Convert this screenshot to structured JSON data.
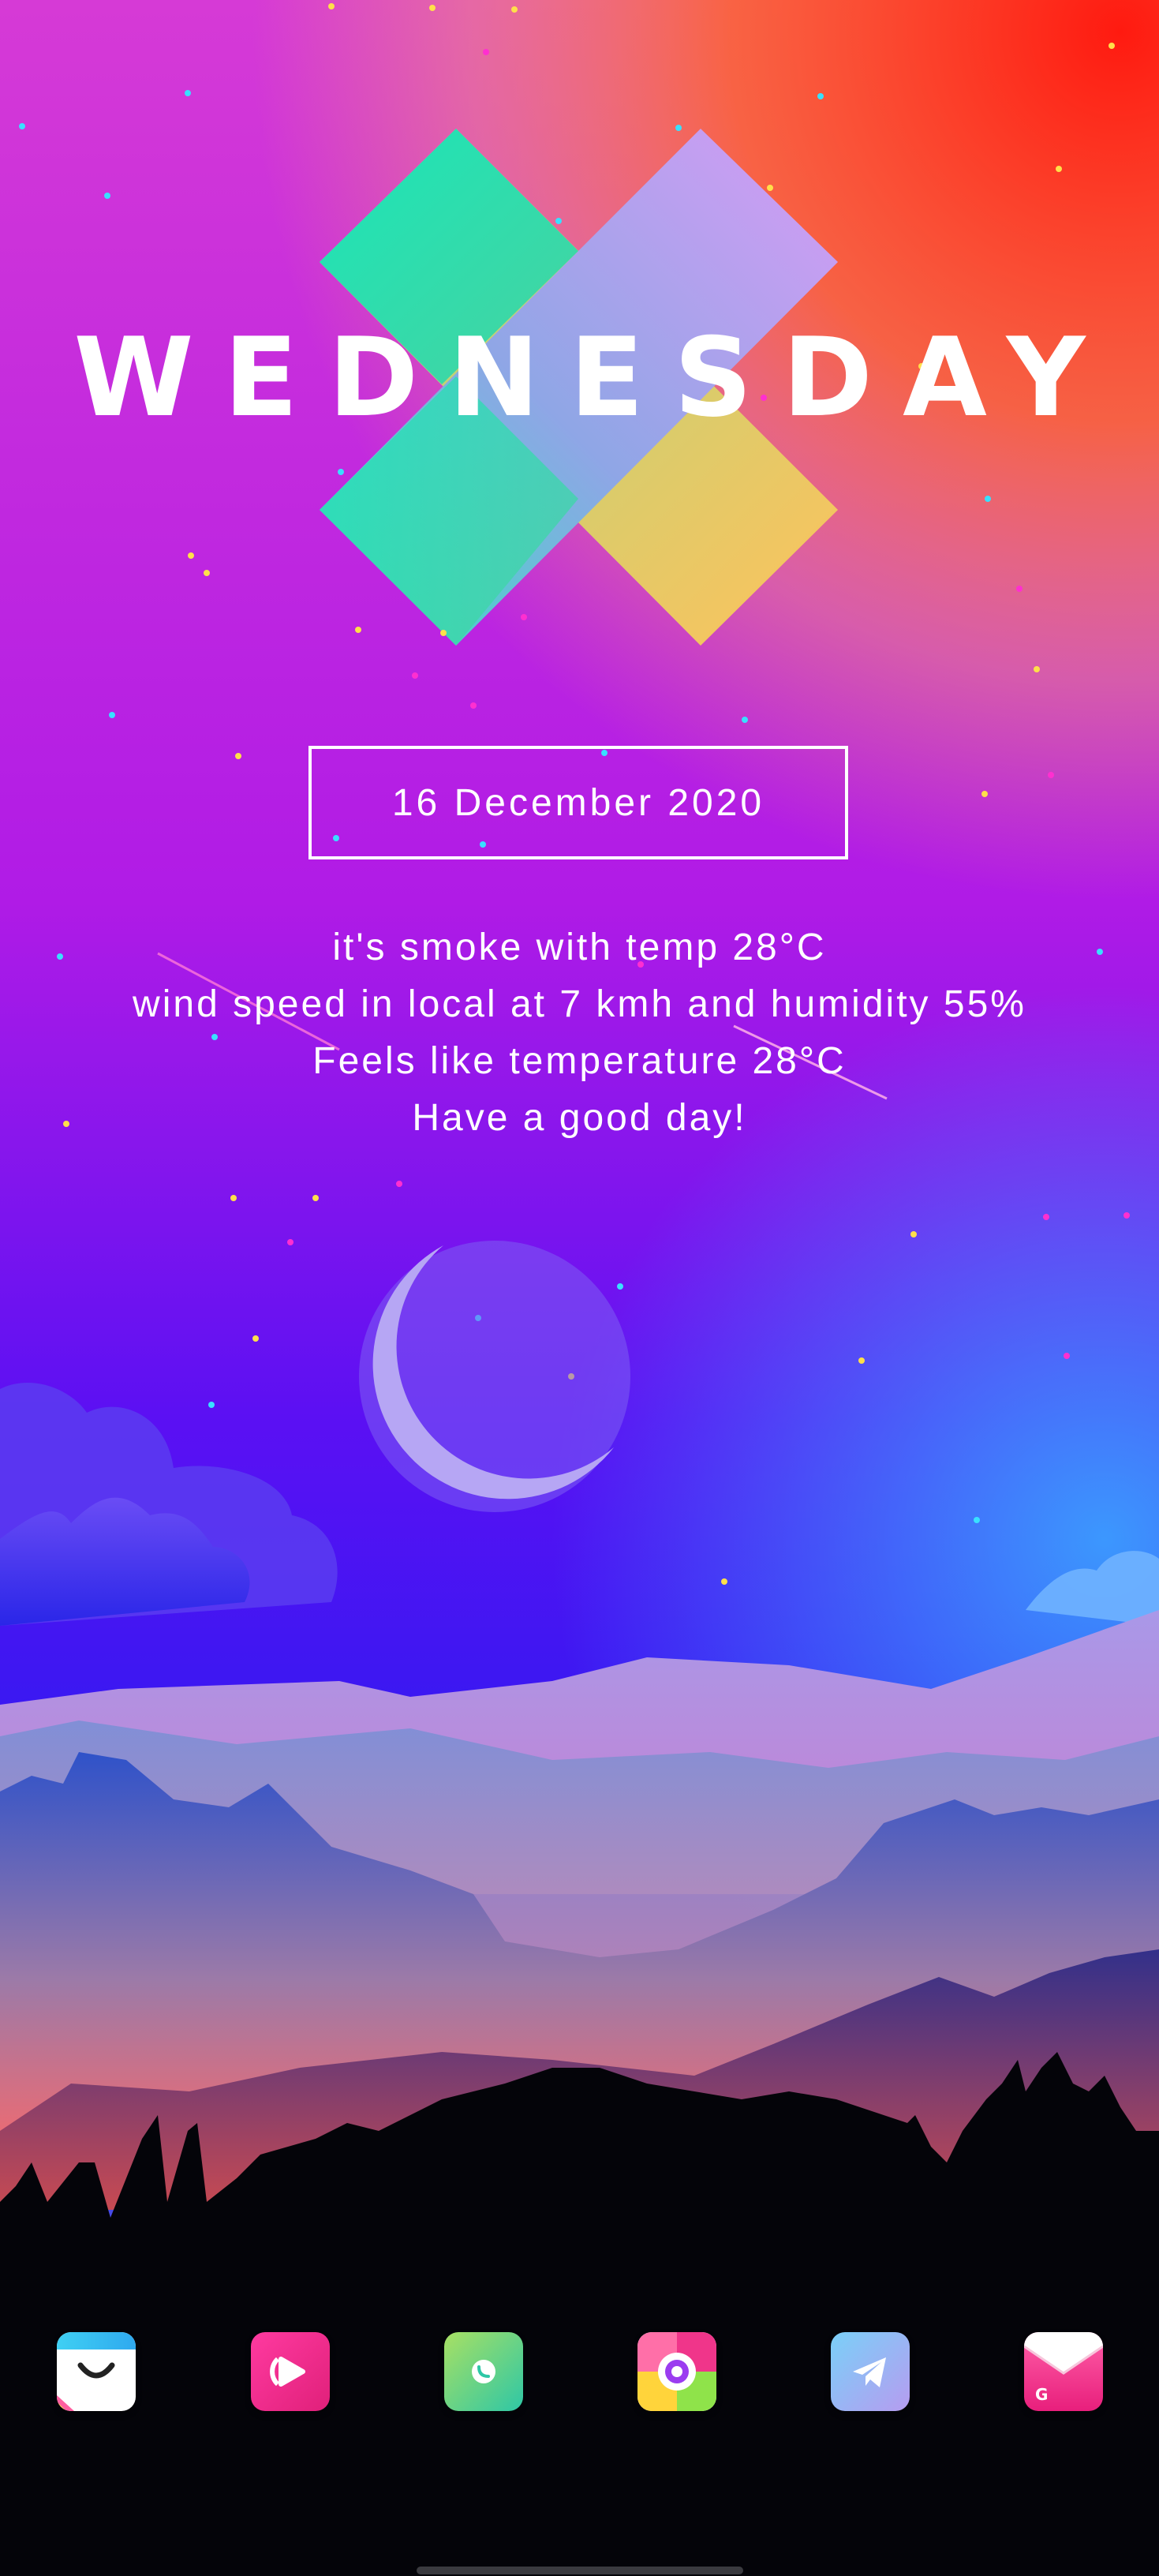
{
  "wallpaper": {
    "day": "WEDNESDAY",
    "date": "16 December 2020",
    "weather_lines": [
      "it's smoke with temp 28°C",
      "wind speed in local at 7 kmh and humidity 55%",
      "Feels like temperature 28°C",
      "Have a good day!"
    ]
  },
  "dock": {
    "apps": [
      {
        "icon": "shopping-bag-icon",
        "color": "#ffffff"
      },
      {
        "icon": "video-player-icon",
        "color": "#ec2d8e"
      },
      {
        "icon": "phone-icon",
        "color": "#4fd3a0"
      },
      {
        "icon": "browser-icon",
        "color": "#f35d8c"
      },
      {
        "icon": "telegram-icon",
        "color": "#8fb5f6"
      },
      {
        "icon": "gmail-icon",
        "color": "#f0358a"
      }
    ]
  },
  "colors": {
    "top_left": "#c52fd8",
    "top_right": "#ff1b1b",
    "mid_violet": "#5b10f3",
    "ground": "#040409"
  }
}
